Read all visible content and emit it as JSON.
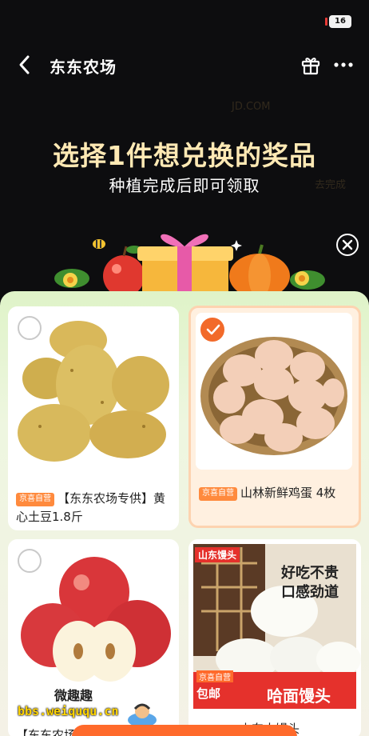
{
  "status_bar": {
    "time": "",
    "battery": "16"
  },
  "nav": {
    "title": "东东农场"
  },
  "heading": {
    "title": "选择1件想兑换的奖品",
    "subtitle": "种植完成后即可领取"
  },
  "background_hints": [
    "JD.COM",
    "去完成"
  ],
  "products": [
    {
      "badge": "京喜自营",
      "name": "【东东农场专供】黄心土豆1.8斤",
      "selected": false,
      "icon": "potato-image"
    },
    {
      "badge": "京喜自营",
      "name": "山林新鲜鸡蛋 4枚",
      "selected": true,
      "icon": "eggs-image"
    },
    {
      "badge": "",
      "name": "【东东农场专供】",
      "selected": false,
      "icon": "apple-image"
    },
    {
      "badge": "京喜自营",
      "name": "山东大馒头",
      "selected": false,
      "icon": "steamed-bun-image",
      "image_tag": "山东馒头",
      "image_slogan_1": "好吃不贵",
      "image_slogan_2": "口感劲道",
      "image_ship": "包邮",
      "image_banner": "哈面馒头"
    }
  ],
  "watermark": {
    "line1": "微趣趣",
    "line2": "bbs.weiququ.cn"
  },
  "colors": {
    "background": "#0d0d0f",
    "headline": "#ffe9b4",
    "accent": "#f26a2a",
    "panel": "#dff3c8"
  }
}
